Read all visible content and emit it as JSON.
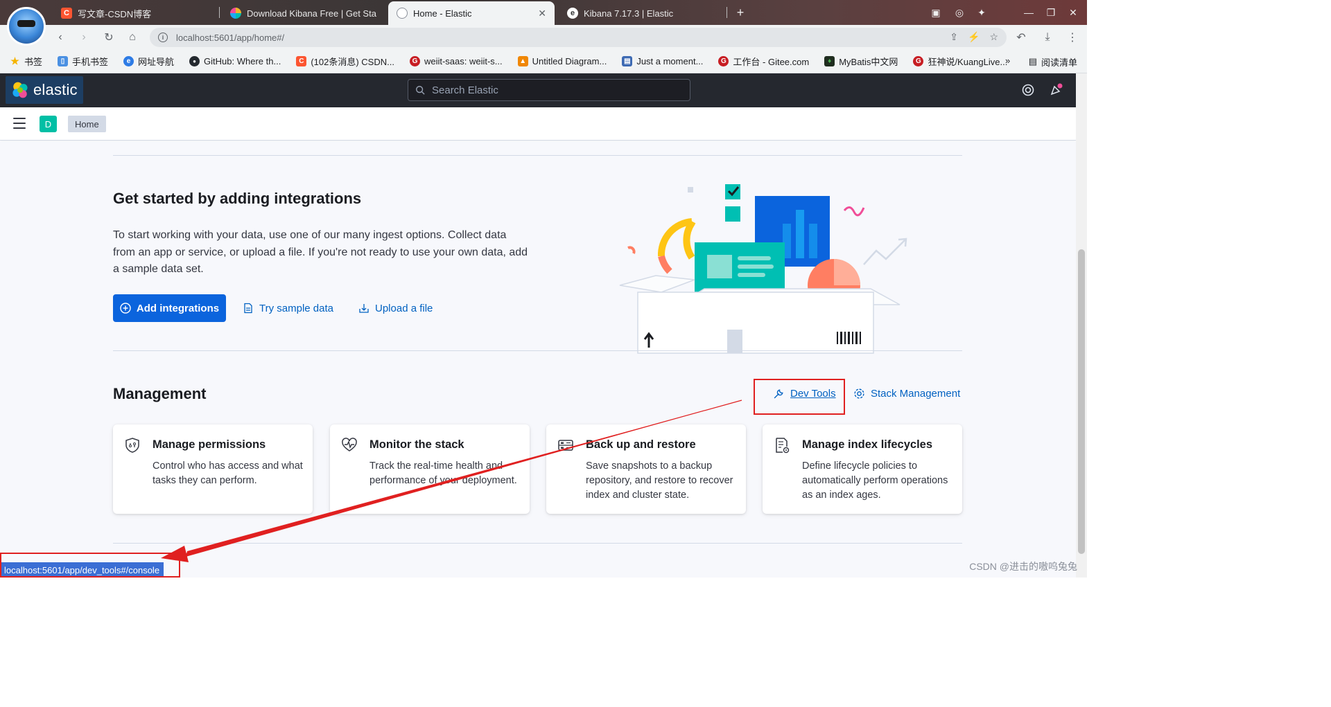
{
  "browser": {
    "tabs": [
      {
        "title": "写文章-CSDN博客",
        "favicon": "C",
        "favicon_color": "#fc5531"
      },
      {
        "title": "Download Kibana Free | Get Sta",
        "favicon": "",
        "favicon_color": "#00bfb3"
      },
      {
        "title": "Home - Elastic",
        "favicon": "",
        "favicon_color": "#8a8f99",
        "active": true
      },
      {
        "title": "Kibana 7.17.3 | Elastic",
        "favicon": "",
        "favicon_color": "#ffffff"
      }
    ],
    "new_tab_label": "+",
    "url": "localhost:5601/app/home#/",
    "bookmarks": [
      {
        "label": "书签",
        "icon_color": "#f5b400",
        "glyph": "★"
      },
      {
        "label": "手机书签",
        "icon_color": "#4a90e2",
        "glyph": "▯"
      },
      {
        "label": "网址导航",
        "icon_color": "#2d7be5",
        "glyph": "e"
      },
      {
        "label": "GitHub: Where th...",
        "icon_color": "#24292f",
        "glyph": "●"
      },
      {
        "label": "(102条消息) CSDN...",
        "icon_color": "#fc5531",
        "glyph": "C"
      },
      {
        "label": "weiit-saas: weiit-s...",
        "icon_color": "#c71d23",
        "glyph": "G"
      },
      {
        "label": "Untitled Diagram...",
        "icon_color": "#f08705",
        "glyph": "▲"
      },
      {
        "label": "Just a moment...",
        "icon_color": "#3d6ab3",
        "glyph": "▤"
      },
      {
        "label": "工作台 - Gitee.com",
        "icon_color": "#c71d23",
        "glyph": "G"
      },
      {
        "label": "MyBatis中文网",
        "icon_color": "#1f2d1f",
        "glyph": "♦"
      },
      {
        "label": "狂神说/KuangLive...",
        "icon_color": "#c71d23",
        "glyph": "G"
      }
    ],
    "bookmarks_more": "»",
    "reading_list": "阅读清单",
    "status_url": "localhost:5601/app/dev_tools#/console",
    "watermark": "CSDN @进击的嗷呜兔兔"
  },
  "kibana": {
    "brand": "elastic",
    "search_placeholder": "Search Elastic",
    "space_initial": "D",
    "breadcrumb": "Home",
    "integrations": {
      "title": "Get started by adding integrations",
      "description": "To start working with your data, use one of our many ingest options. Collect data from an app or service, or upload a file. If you're not ready to use your own data, add a sample data set.",
      "add_button": "Add integrations",
      "sample_link": "Try sample data",
      "upload_link": "Upload a file"
    },
    "management": {
      "title": "Management",
      "dev_tools": "Dev Tools",
      "stack_management": "Stack Management",
      "cards": [
        {
          "title": "Manage permissions",
          "description": "Control who has access and what tasks they can perform.",
          "icon": "security-icon"
        },
        {
          "title": "Monitor the stack",
          "description": "Track the real-time health and performance of your deployment.",
          "icon": "heartbeat-icon"
        },
        {
          "title": "Back up and restore",
          "description": "Save snapshots to a backup repository, and restore to recover index and cluster state.",
          "icon": "storage-icon"
        },
        {
          "title": "Manage index lifecycles",
          "description": "Define lifecycle policies to automatically perform operations as an index ages.",
          "icon": "lifecycle-icon"
        }
      ]
    }
  },
  "colors": {
    "primary": "#0b64dd",
    "link": "#0061c1",
    "header": "#25282f",
    "annotation": "#e02020"
  }
}
